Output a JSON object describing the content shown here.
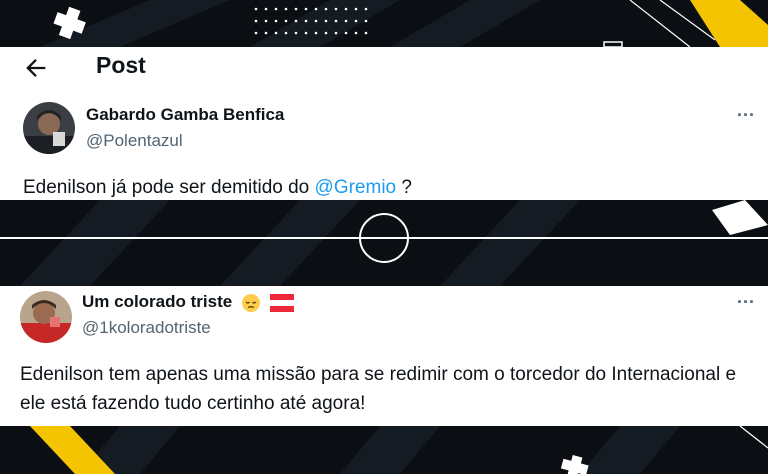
{
  "post_header": {
    "title": "Post",
    "back_icon": "arrow-left-icon"
  },
  "post1": {
    "author_name": "Gabardo Gamba Benfica",
    "author_handle": "@Polentazul",
    "text_before": "Edenilson já pode ser demitido do ",
    "mention": "@Gremio",
    "text_after": " ?",
    "more_label": "···"
  },
  "post2": {
    "author_name": "Um colorado triste",
    "author_handle": "@1koloradotriste",
    "text": "Edenilson tem apenas uma missão para se redimir com o torcedor do Internacional e ele está fazendo tudo certinho até agora!",
    "more_label": "···",
    "name_emojis": [
      "pensive-face-emoji",
      "austria-flag-emoji"
    ]
  },
  "colors": {
    "background": "#0b0f14",
    "accent_yellow": "#f5c400",
    "mention_blue": "#1d9bf0",
    "secondary_text": "#536471"
  }
}
